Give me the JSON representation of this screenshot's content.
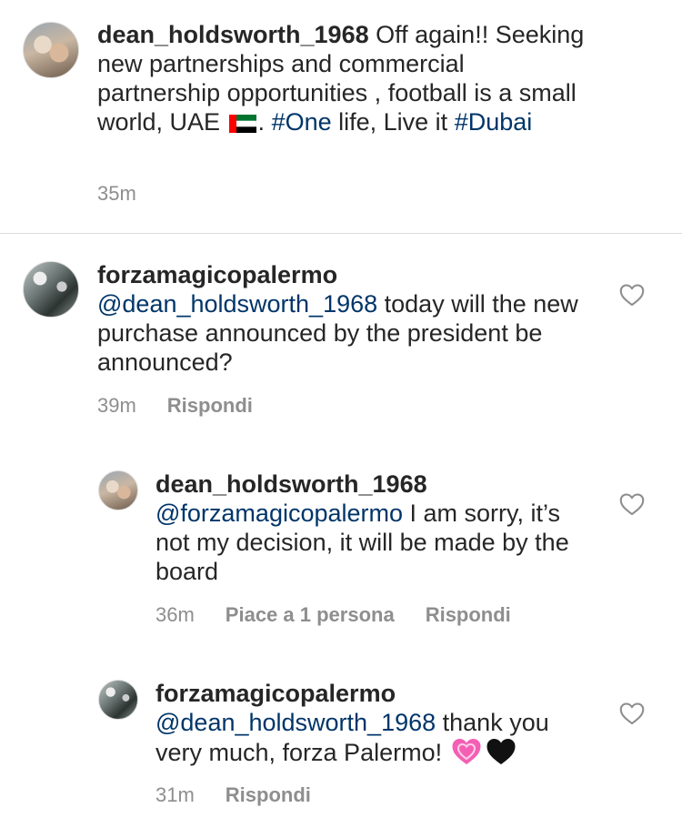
{
  "caption": {
    "username": "dean_holdsworth_1968",
    "text1": " Off again!! Seeking new partnerships and commercial partnership opportunities , football is a small world, UAE ",
    "flag_icon": "uae-flag-icon",
    "text2": ". ",
    "hashtag1": "#One",
    "text3": " life, Live it ",
    "hashtag2": "#Dubai",
    "time": "35m"
  },
  "comments": [
    {
      "username": "forzamagicopalermo",
      "mention": "@dean_holdsworth_1968",
      "text": " today will the new purchase announced by the president be announced?",
      "time": "39m",
      "reply_label": "Rispondi"
    },
    {
      "username": "dean_holdsworth_1968",
      "mention": "@forzamagicopalermo",
      "text": " I am sorry, it’s not my decision, it will be made by the board",
      "time": "36m",
      "likes_label": "Piace a 1 persona",
      "reply_label": "Rispondi"
    },
    {
      "username": "forzamagicopalermo",
      "mention": "@dean_holdsworth_1968",
      "text": " thank you very much, forza Palermo! ",
      "emojis": [
        "pink-heart-emoji",
        "black-heart-emoji"
      ],
      "time": "31m",
      "reply_label": "Rispondi"
    }
  ],
  "colors": {
    "text": "#262626",
    "link": "#003569",
    "meta": "#8e8e8e",
    "divider": "#dbdbdb"
  }
}
